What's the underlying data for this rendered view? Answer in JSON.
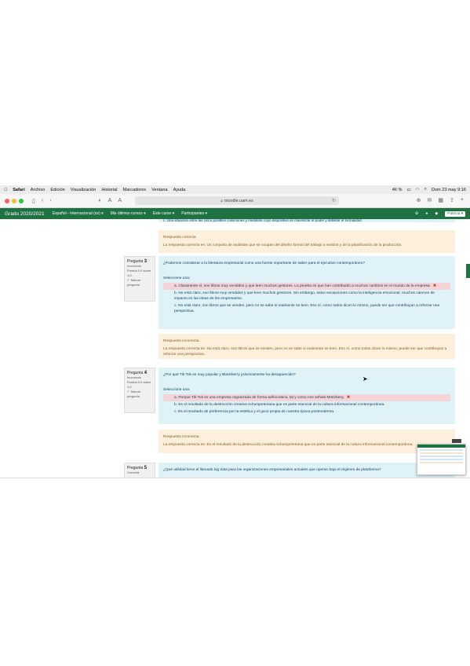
{
  "menubar": {
    "items": [
      "Safari",
      "Archivo",
      "Edición",
      "Visualización",
      "Historial",
      "Marcadores",
      "Ventana",
      "Ayuda"
    ],
    "battery": "46 %",
    "datetime": "Dom 23 may  9:16"
  },
  "browser": {
    "url": "moodle.uam.es",
    "font_small": "A",
    "font_large": "A"
  },
  "navbar": {
    "brand": "Grado 2020/2021",
    "language": "Español - Internacional (es) ▾",
    "recent_courses": "Mis últimos cursos ▾",
    "this_course": "Este curso ▾",
    "participants": "Participantes ▾",
    "user": "Patricia ▾"
  },
  "top_fragment": "c. Una situación entre las cinco posibles coaliciones y mediante cuyo dispositivo se maximizar el poder y debilitar el formalidad",
  "feedback1": {
    "title": "Respuesta correcta",
    "text": "La respuesta correcta es: Un conjunto de analistas que se ocupan del diseño formal del trabajo a realizar y de la planificación de la producción."
  },
  "q3": {
    "label": "Pregunta",
    "number": "3",
    "state": "Incorrecta",
    "score": "Puntúa 0,0 sobre 1,0",
    "flag": "Marcar pregunta",
    "text": "¿Podemos considerar a la literatura empresarial como una fuente importante de saber para el ejecutivo contemporáneo?",
    "select_label": "Seleccione una:",
    "options": [
      "a. Claramente sí, son libros muy vendidos y que leen muchos gestores. La prueba es que han contribuido a muchos cambios en el mundo de la empresa.",
      "b. No está claro, son libros muy vendidos y que leen muchos gestores. Sin embargo, salvo excepciones como la inteligencia emocional, muchos carecen de impacto en las ideas de los empresarios.",
      "c. No está claro, son libros que se venden, pero no se sabe si realmente se leen. Eso sí, como todos dicen lo mismo, puede ser que contribuyan a reforzar una perspectiva."
    ],
    "feedback_title": "Respuesta incorrecta.",
    "feedback_text": "La respuesta correcta es: No está claro, son libros que se venden, pero no se sabe si realmente se leen. Eso sí, como todos dicen lo mismo, puede ser que contribuyan a reforzar una perspectiva."
  },
  "q4": {
    "label": "Pregunta",
    "number": "4",
    "state": "Incorrecta",
    "score": "Puntúa 0,0 sobre 1,0",
    "flag": "Marcar pregunta",
    "text": "¿Por qué Tik Tok es muy popular y Blackberry prácticamente ha desaparecido?",
    "select_label": "Seleccione una:",
    "options": [
      "a. Porque Tik Tok es una empresa organizada de forma adhocrática, tal y como nos señala Mintzberg.",
      "b. Es el resultado de la destrucción creativa schumpeteriana que es parte esencial de la cultura informacional contemporánea.",
      "c. Es el resultado de preferencia por la estética y el goce propia de nuestra época postmoderna."
    ],
    "feedback_title": "Respuesta incorrecta.",
    "feedback_text": "La respuesta correcta es: Es el resultado de la destrucción creativa schumpeteriana que es parte esencial de la cultura informacional contemporánea."
  },
  "q5": {
    "label": "Pregunta",
    "number": "5",
    "state": "Correcta",
    "text_prefix": "¿Qué utilidad tiene el llamado ",
    "text_em": "big data",
    "text_suffix": " para las organizaciones empresariales actuales que operan bajo el régimen de plataforma?"
  },
  "colors": {
    "navbar": "#1e7140",
    "question_bg": "#def2f8",
    "feedback_bg": "#fcefdc",
    "wrong_option_bg": "#f5d4d8"
  }
}
